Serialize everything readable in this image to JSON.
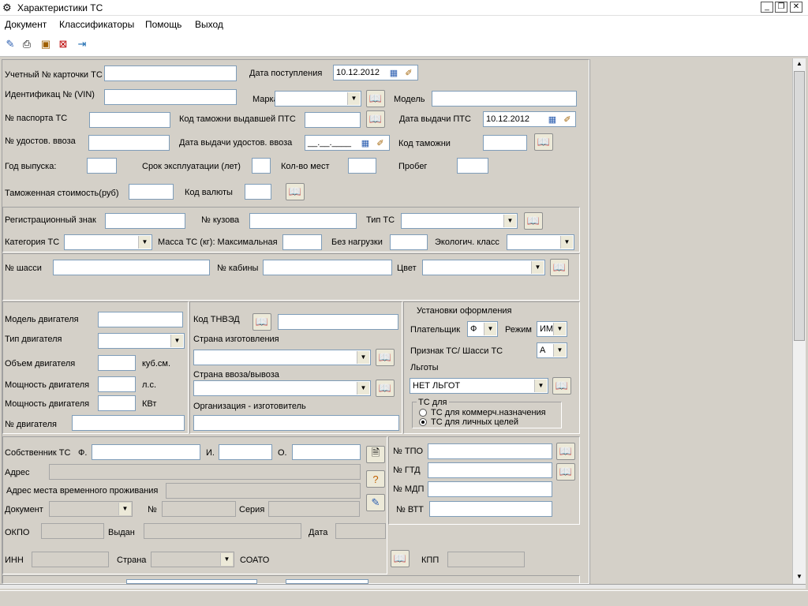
{
  "window": {
    "title": "Характеристики ТС",
    "icon": "gear-icon",
    "controls": [
      "_",
      "▫",
      "✕"
    ]
  },
  "menu": [
    "Документ",
    "Классификаторы",
    "Помощь",
    "Выход"
  ],
  "toolbar_icons": [
    "edit-icon",
    "print-icon",
    "save-icon",
    "close-doc-icon",
    "export-icon"
  ],
  "row1": {
    "card_label": "Учетный № карточки ТС",
    "arrival_label": "Дата поступления",
    "arrival_date": "10.12.2012"
  },
  "row2": {
    "vin_label": "Идентификац № (VIN)",
    "brand_label": "Марка",
    "model_label": "Модель"
  },
  "row3": {
    "passport_label": "№ паспорта  ТС",
    "customs_code_label": "Код таможни выдавшей ПТС",
    "pts_date_label": "Дата выдачи ПТС",
    "pts_date": "10.12.2012"
  },
  "row4": {
    "cert_label": "№  удостов. ввоза",
    "cert_date_label": "Дата выдачи удостов. ввоза",
    "cert_date_placeholder": "__.__.____",
    "customs_label": "Код таможни"
  },
  "row5": {
    "year_label": "Год выпуска:",
    "service_label": "Срок эксплуатации (лет)",
    "seats_label": "Кол-во мест",
    "mileage_label": "Пробег"
  },
  "row6": {
    "cost_label": "Таможенная стоимость(руб)",
    "currency_label": "Код валюты"
  },
  "reg": {
    "regsign_label": "Регистрационный знак",
    "body_label": "№ кузова",
    "type_label": "Тип ТС",
    "category_label": "Категория ТС",
    "mass_label": "Масса ТС (кг): Максимальная",
    "unloaded_label": "Без нагрузки",
    "eco_label": "Экологич. класс"
  },
  "chassis": {
    "chassis_label": "№ шасси",
    "cabin_label": "№ кабины",
    "color_label": "Цвет"
  },
  "engine": {
    "model_label": "Модель двигателя",
    "type_label": "Тип двигателя",
    "volume_label": "Объем двигателя",
    "volume_unit": "куб.см.",
    "power_label": "Мощность двигателя",
    "power_unit_hp": "л.с.",
    "power2_label": "Мощность двигателя",
    "power_unit_kw": "КВт",
    "number_label": "№ двигателя"
  },
  "origin": {
    "tnved_label": "Код ТНВЭД",
    "country_label": "Страна изготовления",
    "import_label": "Страна ввоза/вывоза",
    "org_label": "Организация - изготовитель"
  },
  "settings": {
    "title": "Установки оформления",
    "payer_label": "Плательщик",
    "payer_value": "Ф",
    "mode_label": "Режим",
    "mode_value": "ИМ",
    "sign_label": "Признак ТС/ Шасси ТС",
    "sign_value": "А",
    "benefits_label": "Льготы",
    "benefits_value": "НЕТ ЛЬГОТ",
    "ts_for_title": "ТС для",
    "opt_commercial": "ТС для коммерч.назначения",
    "opt_personal": "ТС для личных целей",
    "selected": "personal"
  },
  "owner": {
    "owner_label": "Собственник ТС",
    "f_label": "Ф.",
    "i_label": "И.",
    "o_label": "О.",
    "address_label": "Адрес",
    "temp_address_label": "Адрес места временного проживания",
    "doc_label": "Документ",
    "num_label": "№",
    "series_label": "Серия",
    "okpo_label": "ОКПО",
    "issued_label": "Выдан",
    "date_label": "Дата",
    "inn_label": "ИНН",
    "country_label": "Страна",
    "soato_label": "СОАТО",
    "kpp_label": "КПП"
  },
  "docs": {
    "tpo_label": "№ ТПО",
    "gtd_label": "№ ГТД",
    "mdp_label": "№ МДП",
    "vtt_label": "№ ВТТ"
  }
}
